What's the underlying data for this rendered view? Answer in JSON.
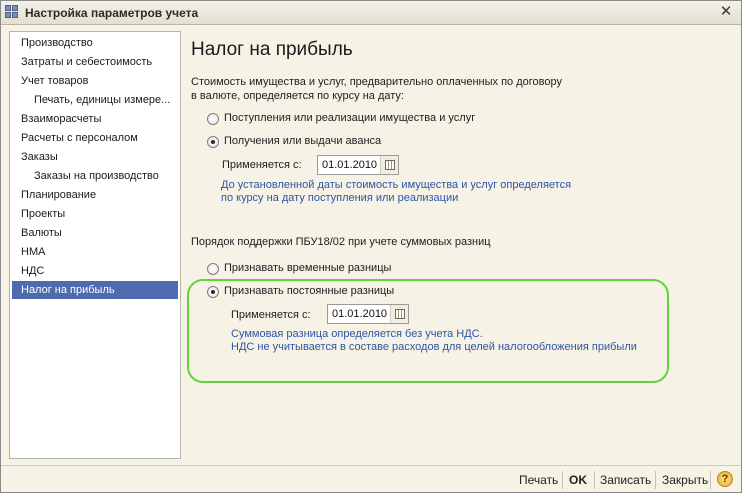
{
  "window": {
    "title": "Настройка параметров учета"
  },
  "nav": {
    "items": [
      {
        "label": "Производство",
        "sub": false
      },
      {
        "label": "Затраты и себестоимость",
        "sub": false
      },
      {
        "label": "Учет товаров",
        "sub": false
      },
      {
        "label": "Печать, единицы измере...",
        "sub": true
      },
      {
        "label": "Взаиморасчеты",
        "sub": false
      },
      {
        "label": "Расчеты с персоналом",
        "sub": false
      },
      {
        "label": "Заказы",
        "sub": false
      },
      {
        "label": "Заказы на производство",
        "sub": true
      },
      {
        "label": "Планирование",
        "sub": false
      },
      {
        "label": "Проекты",
        "sub": false
      },
      {
        "label": "Валюты",
        "sub": false
      },
      {
        "label": "НМА",
        "sub": false
      },
      {
        "label": "НДС",
        "sub": false
      },
      {
        "label": "Налог на прибыль",
        "sub": false,
        "active": true
      }
    ]
  },
  "main": {
    "title": "Налог на прибыль",
    "section1": {
      "label_line1": "Стоимость имущества и услуг, предварительно оплаченных по договору",
      "label_line2": "в валюте, определяется по курсу на дату:",
      "option1": "Поступления или реализации имущества и услуг",
      "option2": "Получения или выдачи аванса",
      "selected": "option2",
      "applies_label": "Применяется с:",
      "date": "01.01.2010",
      "hint_line1": "До установленной даты стоимость имущества и услуг определяется",
      "hint_line2": "по курсу на дату поступления или реализации"
    },
    "section2": {
      "label": "Порядок поддержки ПБУ18/02 при учете суммовых разниц",
      "option1": "Признавать временные разницы",
      "option2": "Признавать постоянные разницы",
      "selected": "option2",
      "applies_label": "Применяется с:",
      "date": "01.01.2010",
      "hint_line1": "Суммовая разница определяется без учета НДС.",
      "hint_line2": "НДС не учитывается в составе расходов для целей налогообложения прибыли"
    },
    "highlight_color": "#61d43b"
  },
  "bottom": {
    "print": "Печать",
    "ok": "OK",
    "save": "Записать",
    "close": "Закрыть",
    "help": "?"
  }
}
